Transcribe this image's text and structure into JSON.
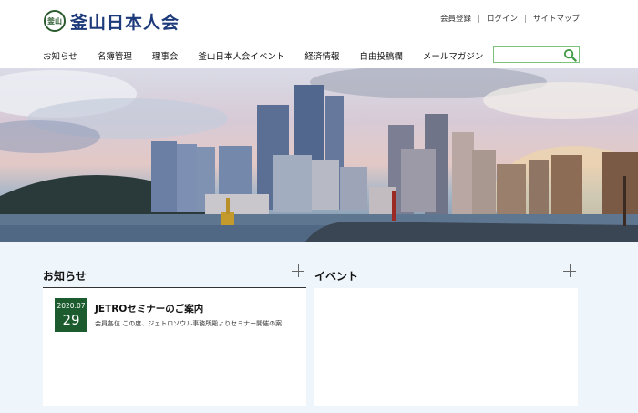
{
  "header": {
    "logo_seal": "釜山",
    "logo_text": "釜山日本人会",
    "util_links": [
      "会員登録",
      "ログイン",
      "サイトマップ"
    ],
    "nav": [
      "お知らせ",
      "名簿管理",
      "理事会",
      "釜山日本人会イベント",
      "経済情報",
      "自由投稿欄",
      "メールマガジン"
    ],
    "search": {
      "value": "",
      "placeholder": ""
    }
  },
  "sections": {
    "news": {
      "title": "お知らせ",
      "items": [
        {
          "ym": "2020.07",
          "day": "29",
          "title": "JETROセミナーのご案内",
          "excerpt": "会員各位 この度、ジェトロソウル事務所殿よりセミナー開催の案..."
        }
      ]
    },
    "events": {
      "title": "イベント"
    }
  },
  "colors": {
    "brand_green": "#1c5b2d",
    "logo_blue": "#1d3a7a",
    "search_border": "#7cc47a",
    "content_bg": "#eef6fb"
  }
}
